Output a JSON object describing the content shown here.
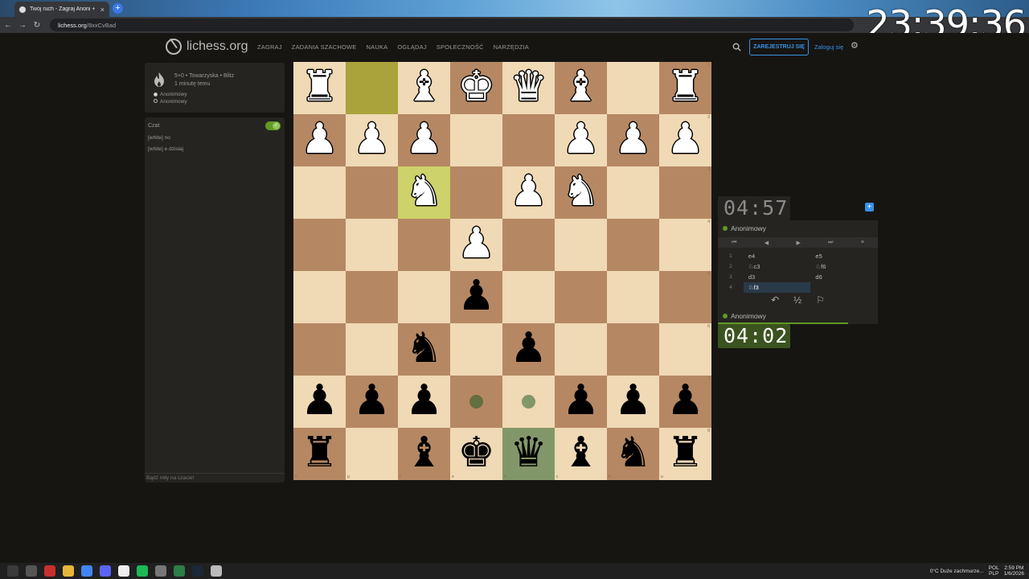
{
  "browser": {
    "tab_title": "Twój ruch - Zagraj Anoni + liche",
    "url_host": "lichess.org",
    "url_path": "/8xxCvBad",
    "overlay_clock": "23:39:36"
  },
  "header": {
    "logo_text": "lichess.org",
    "menu": [
      "ZAGRAJ",
      "ZADANIA SZACHOWE",
      "NAUKA",
      "OGLĄDAJ",
      "SPOŁECZNOŚĆ",
      "NARZĘDZIA"
    ],
    "signup_label": "ZAREJESTRUJ SIĘ",
    "login_label": "Zaloguj się"
  },
  "game_info": {
    "setup": "5+0 • Towarzyska • Blitz",
    "time_ago": "1 minutę temu",
    "players": [
      "Anonimowy",
      "Anonimowy"
    ]
  },
  "chat": {
    "title": "Czat",
    "messages": [
      "[white] no",
      "[white] e dzisiaj"
    ],
    "placeholder": "Bądź miły na czacie!"
  },
  "right_panel": {
    "top_clock": "04:57",
    "top_player": "Anonimowy",
    "bottom_player": "Anonimowy",
    "bottom_clock": "04:02",
    "moves": [
      {
        "num": "1",
        "white": "e4",
        "black": "e5"
      },
      {
        "num": "2",
        "white": "♘c3",
        "black": "♘f6"
      },
      {
        "num": "3",
        "white": "d3",
        "black": "d6"
      },
      {
        "num": "4",
        "white": "♘f3",
        "black": ""
      }
    ]
  },
  "board": {
    "files_bottom": [
      "h",
      "g",
      "f",
      "e",
      "d",
      "c",
      "b",
      "a"
    ],
    "ranks_right": [
      "1",
      "2",
      "3",
      "4",
      "5",
      "6",
      "7",
      "8"
    ],
    "rows": [
      [
        "wR",
        "",
        "wB",
        "wK",
        "wQ",
        "wB",
        "",
        "wR"
      ],
      [
        "wP",
        "wP",
        "wP",
        "",
        "",
        "wP",
        "wP",
        "wP"
      ],
      [
        "",
        "",
        "wN",
        "",
        "wP",
        "wN",
        "",
        ""
      ],
      [
        "",
        "",
        "",
        "wP",
        "",
        "",
        "",
        ""
      ],
      [
        "",
        "",
        "",
        "bP",
        "",
        "",
        "",
        ""
      ],
      [
        "",
        "",
        "bN",
        "",
        "bP",
        "",
        "",
        ""
      ],
      [
        "bP",
        "bP",
        "bP",
        "",
        "",
        "bP",
        "bP",
        "bP"
      ],
      [
        "bR",
        "",
        "bB",
        "bK",
        "bQ",
        "bB",
        "bN",
        "bR"
      ]
    ],
    "highlights": {
      "0-1": "last-move",
      "2-2": "last-move",
      "7-4": "selected"
    },
    "move_dots": [
      "6-3",
      "6-4"
    ]
  },
  "taskbar": {
    "weather": "0°C  Duże zachmurze...",
    "lang": "POL\nPLP",
    "time": "2:59 PM",
    "date": "1/6/2026"
  }
}
